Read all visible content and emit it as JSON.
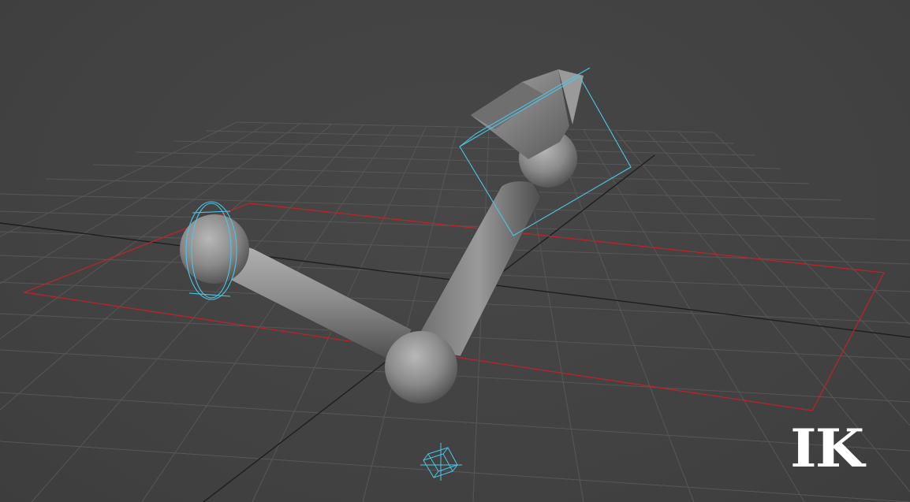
{
  "viewport": {
    "mode_label": "IK",
    "colors": {
      "background": "#434343",
      "grid": "#575757",
      "axis": "#1e1e1e",
      "selection_box": "#c2222a",
      "ik_handle": "#4cc6e6",
      "bone": "#8a8a8a",
      "end_effector": "#7f7f7f"
    },
    "icons": {
      "root_controller": "circle-controller-icon",
      "end_controller": "box-controller-icon",
      "pole_vector": "locator-icon"
    }
  }
}
